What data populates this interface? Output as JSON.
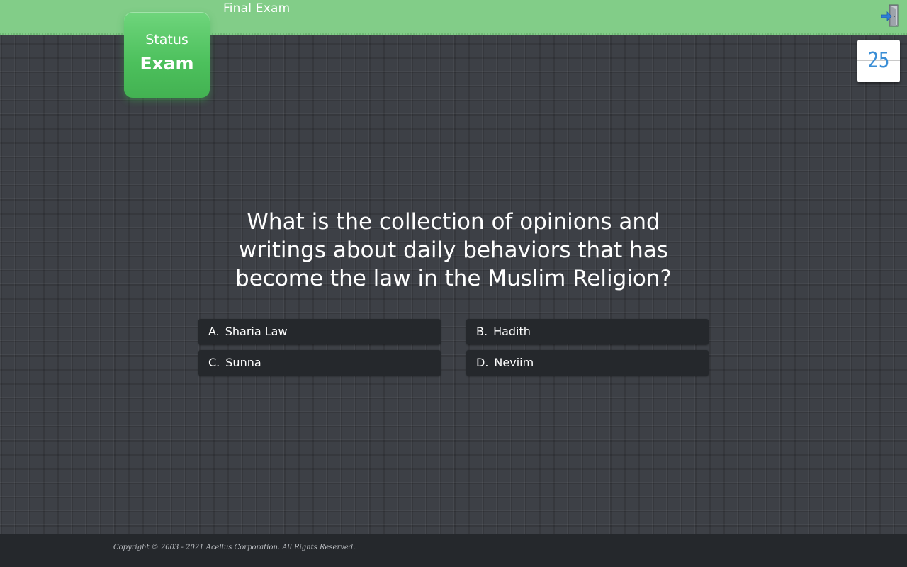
{
  "header": {
    "title": "Final Exam",
    "exit_icon": "exit-door-icon",
    "background_color": "#82cd88"
  },
  "status_tile": {
    "link_label": "Status",
    "value": "Exam",
    "color": "#4cc05c"
  },
  "counter": {
    "value": "25",
    "color": "#3a8ed6"
  },
  "question": {
    "text": "What is the collection of opinions and writings about daily behaviors that has become the law in the Muslim Religion?"
  },
  "answers": [
    {
      "letter": "A.",
      "label": "Sharia Law"
    },
    {
      "letter": "B.",
      "label": "Hadith"
    },
    {
      "letter": "C.",
      "label": "Sunna"
    },
    {
      "letter": "D.",
      "label": "Neviim"
    }
  ],
  "footer": {
    "copyright": "Copyright © 2003 - 2021 Acellus Corporation.  All Rights Reserved."
  }
}
